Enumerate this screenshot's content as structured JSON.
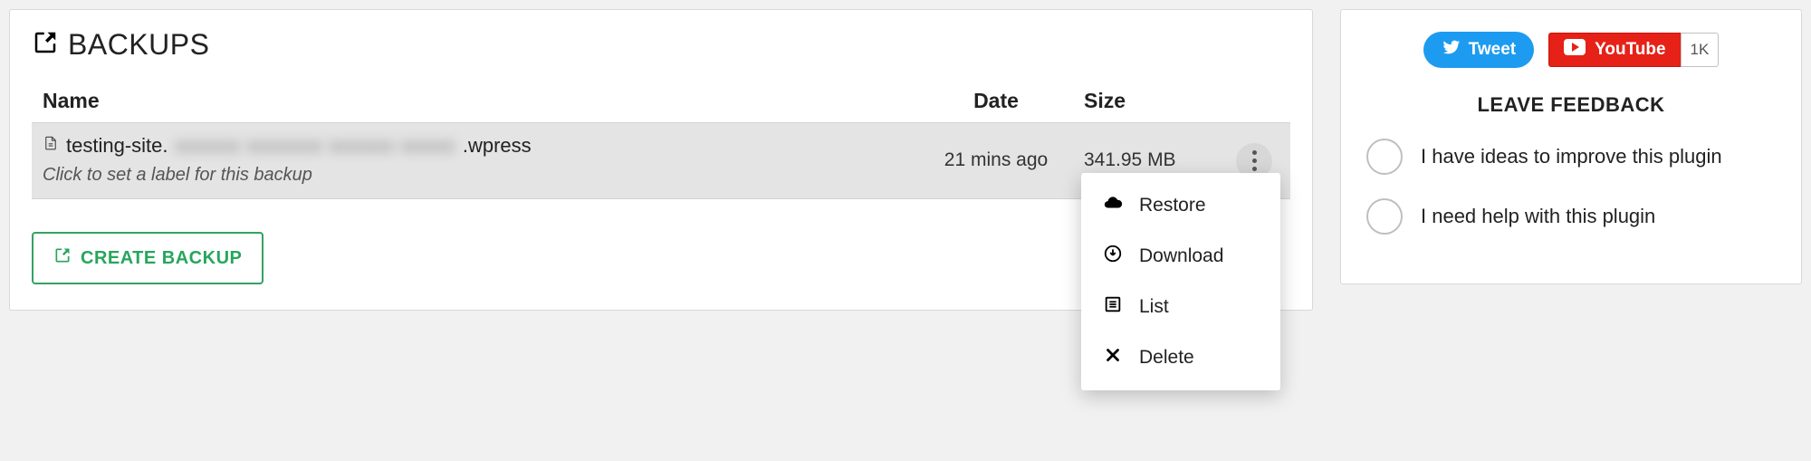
{
  "left": {
    "title": "BACKUPS",
    "columns": {
      "name": "Name",
      "date": "Date",
      "size": "Size"
    },
    "row": {
      "name_prefix": "testing-site.",
      "name_hidden": "xxxxxx xxxxxxx xxxxxx xxxxx",
      "name_suffix": ".wpress",
      "label_hint": "Click to set a label for this backup",
      "date": "21 mins ago",
      "size": "341.95 MB"
    },
    "create_label": "CREATE BACKUP",
    "menu": {
      "restore": "Restore",
      "download": "Download",
      "list": "List",
      "delete": "Delete"
    }
  },
  "right": {
    "tweet": "Tweet",
    "youtube": "YouTube",
    "youtube_count": "1K",
    "feedback_title": "LEAVE FEEDBACK",
    "option1": "I have ideas to improve this plugin",
    "option2": "I need help with this plugin"
  }
}
